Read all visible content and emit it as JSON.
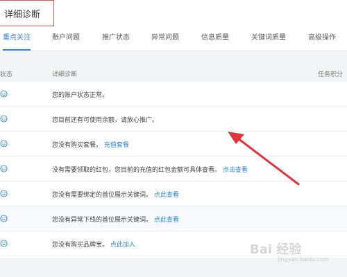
{
  "header": {
    "title": "详细诊断"
  },
  "tabs": [
    {
      "label": "重点关注",
      "active": true
    },
    {
      "label": "账户问题"
    },
    {
      "label": "推广状态"
    },
    {
      "label": "异常问题"
    },
    {
      "label": "信息质量"
    },
    {
      "label": "关键词质量"
    },
    {
      "label": "高级操作"
    }
  ],
  "table": {
    "headers": {
      "status": "状态",
      "detail": "详细诊断",
      "score": "任务积分"
    },
    "rows": [
      {
        "text": "您的账户状态正常。",
        "link": ""
      },
      {
        "text": "您目前还有可使用余额，请放心推广。",
        "link": ""
      },
      {
        "text": "您没有购买套餐。",
        "link": "充值套餐"
      },
      {
        "text": "没有需要领取的红包，您目前的充值的红包金额可具体查看。",
        "link": "点击查看"
      },
      {
        "text": "您没有需要绑定的首位展示关键词。",
        "link": "点此查看"
      },
      {
        "text": "您没有异常下线的首位展示关键词。",
        "link": "点此查看"
      },
      {
        "text": "您没有购买品牌宝。",
        "link": "点此加入"
      }
    ]
  },
  "watermark": {
    "brand": "Bai 经验",
    "url": "jingyan.baidu.com"
  },
  "colors": {
    "accent": "#2f86e0",
    "highlight": "#e8524a",
    "arrow": "#e8303a"
  }
}
